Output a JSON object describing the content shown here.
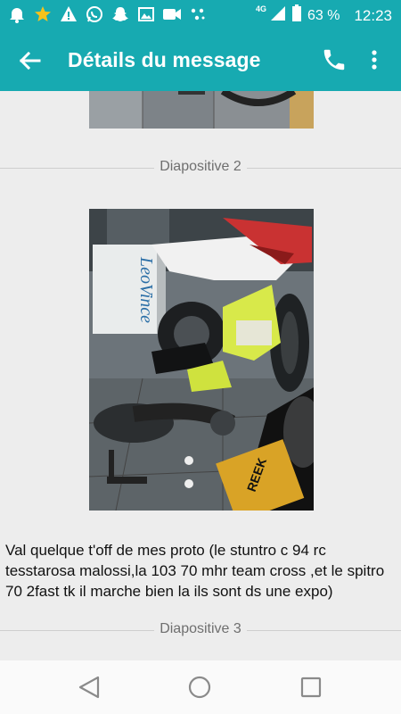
{
  "status_bar": {
    "network": "4G",
    "battery": "63 %",
    "time": "12:23",
    "left_icons": [
      "notification-bell-icon",
      "star-icon",
      "warning-icon",
      "whatsapp-icon",
      "snapchat-icon",
      "image-icon",
      "video-camera-icon",
      "dots-app-icon"
    ]
  },
  "header": {
    "title": "Détails du message",
    "back_icon": "arrow-back-icon",
    "call_icon": "phone-icon",
    "menu_icon": "more-vert-icon"
  },
  "messages": {
    "slide2_label": "Diapositive 2",
    "slide3_label": "Diapositive 3",
    "text": "Val quelque t'off de mes proto (le stuntro c 94 rc tesstarosa malossi,la 103 70 mhr team cross ,et le spitro 70 2fast tk il marche bien la ils sont ds une expo)",
    "photo_sign_text": "LeoVince",
    "photo_sticker_text": "REEK"
  },
  "nav": {
    "back_icon": "nav-back-icon",
    "home_icon": "nav-home-icon",
    "recents_icon": "nav-recents-icon"
  },
  "colors": {
    "accent": "#17aab1",
    "background": "#ededed",
    "text": "#111111",
    "muted": "#6f6f6f"
  }
}
